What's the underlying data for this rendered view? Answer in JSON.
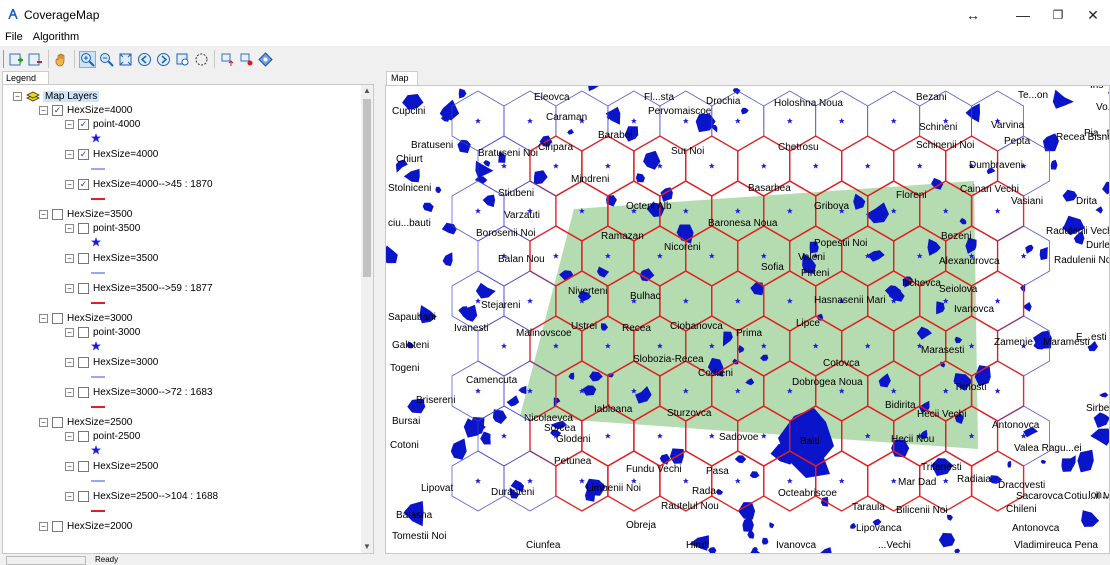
{
  "window": {
    "title": "CoverageMap",
    "controls": [
      "↔",
      "—",
      "❐",
      "✕"
    ]
  },
  "menu": [
    "File",
    "Algorithm"
  ],
  "toolbar": {
    "buttons": [
      "add-layer-icon",
      "remove-layer-icon",
      "pan-icon",
      "zoom-in-icon",
      "zoom-out-icon",
      "zoom-extent-icon",
      "back-icon",
      "forward-icon",
      "zoom-rect-icon",
      "select-circle-icon",
      "layer-up-icon",
      "layer-down-icon",
      "diamond-icon"
    ]
  },
  "legend": {
    "tab_label": "Legend",
    "root_label": "Map Layers",
    "groups": [
      {
        "name": "HexSize=4000",
        "checked": true,
        "point": "point-4000",
        "hex": "HexSize=4000",
        "result": "HexSize=4000-->45 : 1870"
      },
      {
        "name": "HexSize=3500",
        "checked": false,
        "point": "point-3500",
        "hex": "HexSize=3500",
        "result": "HexSize=3500-->59 : 1877"
      },
      {
        "name": "HexSize=3000",
        "checked": false,
        "point": "point-3000",
        "hex": "HexSize=3000",
        "result": "HexSize=3000-->72 : 1683"
      },
      {
        "name": "HexSize=2500",
        "checked": false,
        "point": "point-2500",
        "hex": "HexSize=2500",
        "result": "HexSize=2500-->104 : 1688"
      },
      {
        "name": "HexSize=2000",
        "checked": false
      }
    ]
  },
  "map": {
    "tab_label": "Map",
    "colors": {
      "area": "#a8d5a2",
      "hex_blue": "#4040d0",
      "hex_red": "#e02020",
      "settle": "#0a14c8",
      "star": "#1a1ae0"
    },
    "labels": [
      {
        "t": "Eleovca"
      },
      {
        "t": "Fl...sta"
      },
      {
        "t": "Drochia"
      },
      {
        "t": "Holoshna Noua"
      },
      {
        "t": "Bezani"
      },
      {
        "t": "Te...on"
      },
      {
        "t": "Cupcini"
      },
      {
        "t": "Caraman"
      },
      {
        "t": "Pervomaiscoe"
      },
      {
        "t": "Schineni"
      },
      {
        "t": "Varvina"
      },
      {
        "t": "Baraboi"
      },
      {
        "t": "Ciripara"
      },
      {
        "t": "Bratuseni"
      },
      {
        "t": "Bratuseni Noi"
      },
      {
        "t": "Sur Noi"
      },
      {
        "t": "Chetrosu"
      },
      {
        "t": "Schinenii Noi"
      },
      {
        "t": "Pepta"
      },
      {
        "t": "Chiurt"
      },
      {
        "t": "Dumbraveni"
      },
      {
        "t": "Mindreni"
      },
      {
        "t": "Stolniceni"
      },
      {
        "t": "Stiubeni"
      },
      {
        "t": "Octeni Alb"
      },
      {
        "t": "Basarbea"
      },
      {
        "t": "Gribova"
      },
      {
        "t": "Floreni"
      },
      {
        "t": "Cainari Vechi"
      },
      {
        "t": "Vasiani"
      },
      {
        "t": "Drita"
      },
      {
        "t": "Varzauti"
      },
      {
        "t": "Baronesa Noua"
      },
      {
        "t": "Radulenii Vechi"
      },
      {
        "t": "ciu...bauti"
      },
      {
        "t": "Borosenii Noi"
      },
      {
        "t": "Ramazan"
      },
      {
        "t": "Popestii Noi"
      },
      {
        "t": "Bezeni"
      },
      {
        "t": "Durlesti"
      },
      {
        "t": "Nicoreni"
      },
      {
        "t": "Balan Nou"
      },
      {
        "t": "Valeni"
      },
      {
        "t": "Alexandrovca"
      },
      {
        "t": "Radulenii Noi"
      },
      {
        "t": "Sofia"
      },
      {
        "t": "Pirteni"
      },
      {
        "t": "Ilichevca"
      },
      {
        "t": "Seiolova"
      },
      {
        "t": "Niverteni"
      },
      {
        "t": "Bulhac"
      },
      {
        "t": "Hasnasenii Mari"
      },
      {
        "t": "Stejareni"
      },
      {
        "t": "Ivanovca"
      },
      {
        "t": "Sapaubani"
      },
      {
        "t": "Ivanesti"
      },
      {
        "t": "Malinovscoe"
      },
      {
        "t": "Ustrei"
      },
      {
        "t": "Recea"
      },
      {
        "t": "Ciobanovca"
      },
      {
        "t": "Prima"
      },
      {
        "t": "Lipce"
      },
      {
        "t": "Zamenie"
      },
      {
        "t": "Maramesti"
      },
      {
        "t": "Galateni"
      },
      {
        "t": "Marasesti"
      },
      {
        "t": "Togeni"
      },
      {
        "t": "Slobozia-Recea"
      },
      {
        "t": "Cotovca"
      },
      {
        "t": "Camencuta"
      },
      {
        "t": "Codreni"
      },
      {
        "t": "Dobrogea Noua"
      },
      {
        "t": "Tirnosti"
      },
      {
        "t": "Brisereni"
      },
      {
        "t": "Nicolaevca"
      },
      {
        "t": "Iabloana"
      },
      {
        "t": "Bidirita"
      },
      {
        "t": "Hecii Vechi"
      },
      {
        "t": "Sirbe"
      },
      {
        "t": "Bursai"
      },
      {
        "t": "Sturzovca"
      },
      {
        "t": "Antonovca"
      },
      {
        "t": "Sorcea"
      },
      {
        "t": "Glodeni"
      },
      {
        "t": "Sadovoe"
      },
      {
        "t": "Cotoni"
      },
      {
        "t": "Balti"
      },
      {
        "t": "Hecii Nou"
      },
      {
        "t": "Valea Ragu...ei"
      },
      {
        "t": "Petunea"
      },
      {
        "t": "Trifanesti"
      },
      {
        "t": "Fundu Vechi"
      },
      {
        "t": "Pasa"
      },
      {
        "t": "Lipovat"
      },
      {
        "t": "Duranteni"
      },
      {
        "t": "Limbenii Noi"
      },
      {
        "t": "Mar Dad"
      },
      {
        "t": "Radiaia"
      },
      {
        "t": "Dracovesti"
      },
      {
        "t": "Rada"
      },
      {
        "t": "Octeabriscoe"
      },
      {
        "t": "Sacarovca"
      },
      {
        "t": "Cotiu...ii M"
      },
      {
        "t": "Balasna"
      },
      {
        "t": "Rautelul Nou"
      },
      {
        "t": "Taraula"
      },
      {
        "t": "Bilicenii Noi"
      },
      {
        "t": "Chileni"
      },
      {
        "t": "Tomestii Noi"
      },
      {
        "t": "Obreja"
      },
      {
        "t": "Lipovanca"
      },
      {
        "t": "Antonovca"
      },
      {
        "t": "Ciunfea"
      },
      {
        "t": "Hiruti"
      },
      {
        "t": "Ivanovca"
      },
      {
        "t": "...Vechi"
      },
      {
        "t": "Vladimireuca Pena"
      },
      {
        "t": "Ion..."
      },
      {
        "t": "Ins"
      },
      {
        "t": "Vo...ine"
      },
      {
        "t": "Recea Bisne"
      },
      {
        "t": "E...esti"
      },
      {
        "t": "Pia...ta"
      }
    ]
  },
  "status": {
    "text": "Ready"
  }
}
